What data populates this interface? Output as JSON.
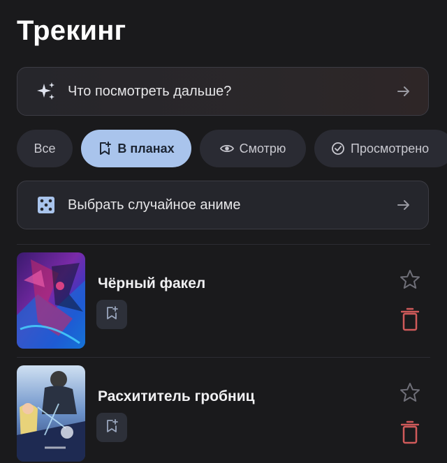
{
  "page": {
    "title": "Трекинг"
  },
  "suggest": {
    "label": "Что посмотреть дальше?",
    "icon": "sparkles-icon"
  },
  "filters": [
    {
      "label": "Все",
      "active": false,
      "icon": ""
    },
    {
      "label": "В планах",
      "active": true,
      "icon": "bookmark-plus-icon"
    },
    {
      "label": "Смотрю",
      "active": false,
      "icon": "eye-icon"
    },
    {
      "label": "Просмотрено",
      "active": false,
      "icon": "check-circle-icon"
    }
  ],
  "random": {
    "label": "Выбрать случайное аниме",
    "icon": "dice-icon"
  },
  "anime": [
    {
      "title": "Чёрный факел"
    },
    {
      "title": "Расхититель гробниц"
    }
  ],
  "colors": {
    "background": "#1a1a1c",
    "active_chip": "#a9c4ec",
    "chip": "#2a2b33",
    "delete": "#d05a5a",
    "dice": "#a9c4ec"
  }
}
